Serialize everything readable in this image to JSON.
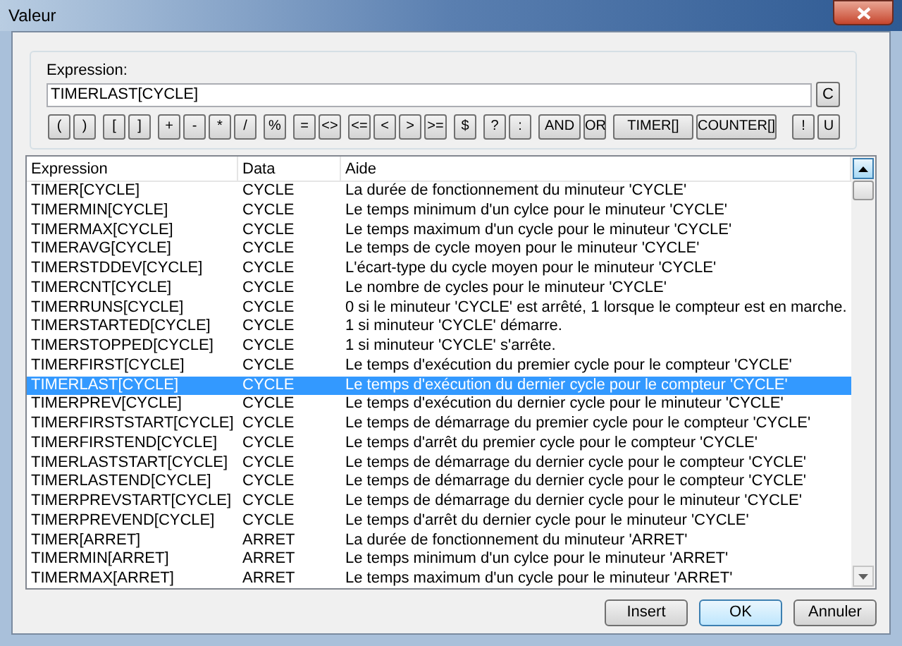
{
  "window": {
    "title": "Valeur"
  },
  "expression": {
    "label": "Expression:",
    "value": "TIMERLAST[CYCLE]",
    "clear_button": "C"
  },
  "operator_groups": [
    [
      "(",
      ")"
    ],
    [
      "[",
      "]"
    ],
    [
      "+",
      "-",
      "*",
      "/"
    ],
    [
      "%"
    ],
    [
      "=",
      "<>"
    ],
    [
      "<=",
      "<",
      ">",
      ">="
    ],
    [
      "$"
    ],
    [
      "?",
      ":"
    ],
    [
      "AND",
      "OR"
    ],
    [
      "TIMER[]",
      "COUNTER[]"
    ],
    [
      "!",
      "U"
    ]
  ],
  "table": {
    "columns": [
      "Expression",
      "Data",
      "Aide"
    ],
    "rows": [
      {
        "expression": "TIMER[CYCLE]",
        "data": "CYCLE",
        "aide": "La durée de fonctionnement du minuteur 'CYCLE'",
        "selected": false
      },
      {
        "expression": "TIMERMIN[CYCLE]",
        "data": "CYCLE",
        "aide": "Le temps minimum d'un cylce pour le minuteur 'CYCLE'",
        "selected": false
      },
      {
        "expression": "TIMERMAX[CYCLE]",
        "data": "CYCLE",
        "aide": "Le temps maximum d'un cycle pour le minuteur 'CYCLE'",
        "selected": false
      },
      {
        "expression": "TIMERAVG[CYCLE]",
        "data": "CYCLE",
        "aide": "Le temps de cycle moyen pour le minuteur 'CYCLE'",
        "selected": false
      },
      {
        "expression": "TIMERSTDDEV[CYCLE]",
        "data": "CYCLE",
        "aide": "L'écart-type du cycle moyen pour le minuteur 'CYCLE'",
        "selected": false
      },
      {
        "expression": "TIMERCNT[CYCLE]",
        "data": "CYCLE",
        "aide": "Le nombre de cycles pour le minuteur 'CYCLE'",
        "selected": false
      },
      {
        "expression": "TIMERRUNS[CYCLE]",
        "data": "CYCLE",
        "aide": "0 si le minuteur 'CYCLE' est arrêté, 1 lorsque le compteur est en marche.",
        "selected": false
      },
      {
        "expression": "TIMERSTARTED[CYCLE]",
        "data": "CYCLE",
        "aide": "1 si minuteur 'CYCLE' démarre.",
        "selected": false
      },
      {
        "expression": "TIMERSTOPPED[CYCLE]",
        "data": "CYCLE",
        "aide": "1 si minuteur 'CYCLE' s'arrête.",
        "selected": false
      },
      {
        "expression": "TIMERFIRST[CYCLE]",
        "data": "CYCLE",
        "aide": "Le temps d'exécution du premier cycle pour le compteur 'CYCLE'",
        "selected": false
      },
      {
        "expression": "TIMERLAST[CYCLE]",
        "data": "CYCLE",
        "aide": "Le temps d'exécution du dernier cycle pour le compteur 'CYCLE'",
        "selected": true
      },
      {
        "expression": "TIMERPREV[CYCLE]",
        "data": "CYCLE",
        "aide": "Le temps d'exécution du dernier cycle pour le minuteur 'CYCLE'",
        "selected": false
      },
      {
        "expression": "TIMERFIRSTSTART[CYCLE]",
        "data": "CYCLE",
        "aide": "Le temps de démarrage du premier cycle pour le compteur 'CYCLE'",
        "selected": false
      },
      {
        "expression": "TIMERFIRSTEND[CYCLE]",
        "data": "CYCLE",
        "aide": "Le temps d'arrêt du premier cycle pour le compteur 'CYCLE'",
        "selected": false
      },
      {
        "expression": "TIMERLASTSTART[CYCLE]",
        "data": "CYCLE",
        "aide": "Le temps de démarrage du dernier cycle pour le compteur 'CYCLE'",
        "selected": false
      },
      {
        "expression": "TIMERLASTEND[CYCLE]",
        "data": "CYCLE",
        "aide": "Le temps de démarrage du dernier cycle pour le compteur 'CYCLE'",
        "selected": false
      },
      {
        "expression": "TIMERPREVSTART[CYCLE]",
        "data": "CYCLE",
        "aide": "Le temps de démarrage du dernier cycle pour le minuteur 'CYCLE'",
        "selected": false
      },
      {
        "expression": "TIMERPREVEND[CYCLE]",
        "data": "CYCLE",
        "aide": "Le temps d'arrêt du dernier cycle pour le minuteur 'CYCLE'",
        "selected": false
      },
      {
        "expression": "TIMER[ARRET]",
        "data": "ARRET",
        "aide": "La durée de fonctionnement du minuteur 'ARRET'",
        "selected": false
      },
      {
        "expression": "TIMERMIN[ARRET]",
        "data": "ARRET",
        "aide": "Le temps minimum d'un cylce pour le minuteur 'ARRET'",
        "selected": false
      },
      {
        "expression": "TIMERMAX[ARRET]",
        "data": "ARRET",
        "aide": "Le temps maximum d'un cycle pour le minuteur 'ARRET'",
        "selected": false
      }
    ]
  },
  "buttons": [
    {
      "label": "Insert",
      "default": false
    },
    {
      "label": "OK",
      "default": true
    },
    {
      "label": "Annuler",
      "default": false
    }
  ]
}
